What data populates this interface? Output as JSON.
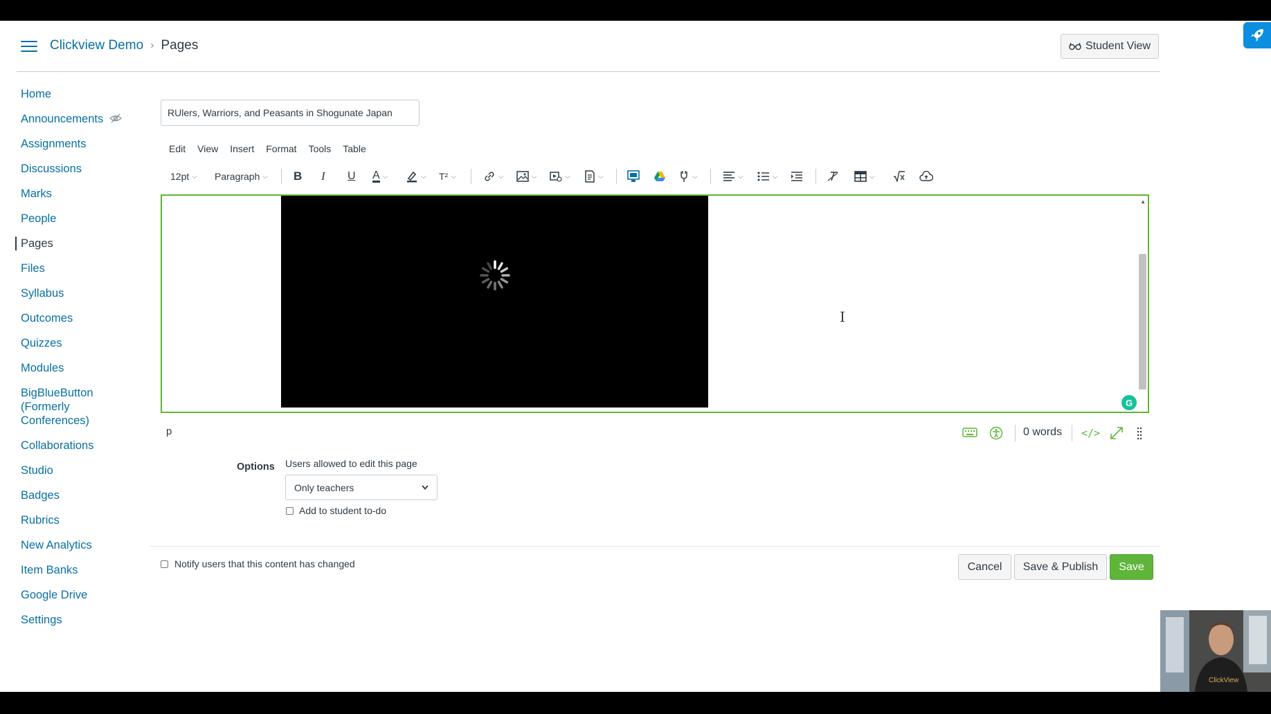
{
  "header": {
    "breadcrumb": {
      "course": "Clickview Demo",
      "page": "Pages"
    },
    "student_view_label": "Student View"
  },
  "sidebar": {
    "items": [
      {
        "label": "Home"
      },
      {
        "label": "Announcements"
      },
      {
        "label": "Assignments"
      },
      {
        "label": "Discussions"
      },
      {
        "label": "Marks"
      },
      {
        "label": "People"
      },
      {
        "label": "Pages"
      },
      {
        "label": "Files"
      },
      {
        "label": "Syllabus"
      },
      {
        "label": "Outcomes"
      },
      {
        "label": "Quizzes"
      },
      {
        "label": "Modules"
      },
      {
        "label": "BigBlueButton (Formerly Conferences)"
      },
      {
        "label": "Collaborations"
      },
      {
        "label": "Studio"
      },
      {
        "label": "Badges"
      },
      {
        "label": "Rubrics"
      },
      {
        "label": "New Analytics"
      },
      {
        "label": "Item Banks"
      },
      {
        "label": "Google Drive"
      },
      {
        "label": "Settings"
      }
    ],
    "active": "Pages"
  },
  "page_title_value": "RUlers, Warriors, and Peasants in Shogunate Japan",
  "editor": {
    "menu": [
      "Edit",
      "View",
      "Insert",
      "Format",
      "Tools",
      "Table"
    ],
    "font_size": "12pt",
    "block_format": "Paragraph",
    "superscript_label": "T²",
    "path": "p",
    "word_count": "0 words",
    "html_toggle": "</>",
    "grammarly": "G"
  },
  "options": {
    "label": "Options",
    "edit_label": "Users allowed to edit this page",
    "edit_value": "Only teachers",
    "todo_label": "Add to student to-do"
  },
  "footer": {
    "notify_label": "Notify users that this content has changed",
    "cancel_label": "Cancel",
    "save_publish_label": "Save & Publish",
    "save_label": "Save"
  },
  "colors": {
    "link": "#0770a3",
    "save_green": "#5fb53a",
    "editor_border": "#5fb53a"
  }
}
